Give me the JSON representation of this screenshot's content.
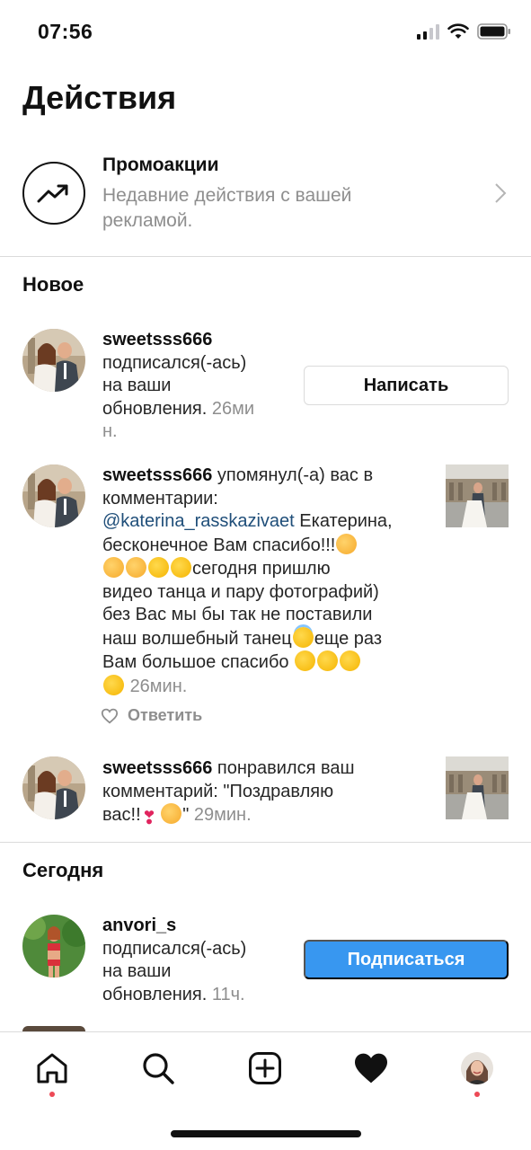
{
  "status_bar": {
    "time": "07:56"
  },
  "page": {
    "title": "Действия"
  },
  "promo": {
    "title": "Промоакции",
    "description": "Недавние действия с вашей рекламой.",
    "icon": "trending-up-icon"
  },
  "sections": {
    "new_title": "Новое",
    "today_title": "Сегодня"
  },
  "notifications": [
    {
      "username": "sweetsss666",
      "text_line1": "подписался(-ась)",
      "text_line2": "на ваши",
      "text_line3": "обновления.",
      "time_part1": "26ми",
      "time_part2": "н.",
      "button_label": "Написать"
    },
    {
      "username": "sweetsss666",
      "action": "упомянул(-а) вас в",
      "action2": "комментарии:",
      "mention": "@katerina_rasskazivaet",
      "line3_rest": "Екатерина,",
      "line4": "бесконечное Вам спасибо!!!",
      "line5": "сегодня пришлю",
      "line6": "видео танца и пару фотографий)",
      "line7": "без Вас мы бы так не поставили",
      "line8a": "наш волшебный танец",
      "line8b": "еще раз",
      "line9": "Вам большое спасибо",
      "time": "26мин.",
      "reply_label": "Ответить"
    },
    {
      "username": "sweetsss666",
      "action": "понравился ваш",
      "line2": "комментарий: \"Поздравляю",
      "line3a": "вас!!",
      "line3b": "\"",
      "time": "29мин."
    },
    {
      "username": "anvori_s",
      "text_line1": "подписался(-ась)",
      "text_line2": "на ваши",
      "text_line3": "обновления.",
      "time": "11ч.",
      "button_label": "Подписаться"
    }
  ],
  "tab_bar": {
    "items": [
      "home-icon",
      "search-icon",
      "new-post-icon",
      "activity-heart-icon",
      "profile-avatar"
    ]
  },
  "colors": {
    "accent": "#3897f0",
    "notification_dot": "#ed4956",
    "secondary_text": "#8e8e8e"
  }
}
